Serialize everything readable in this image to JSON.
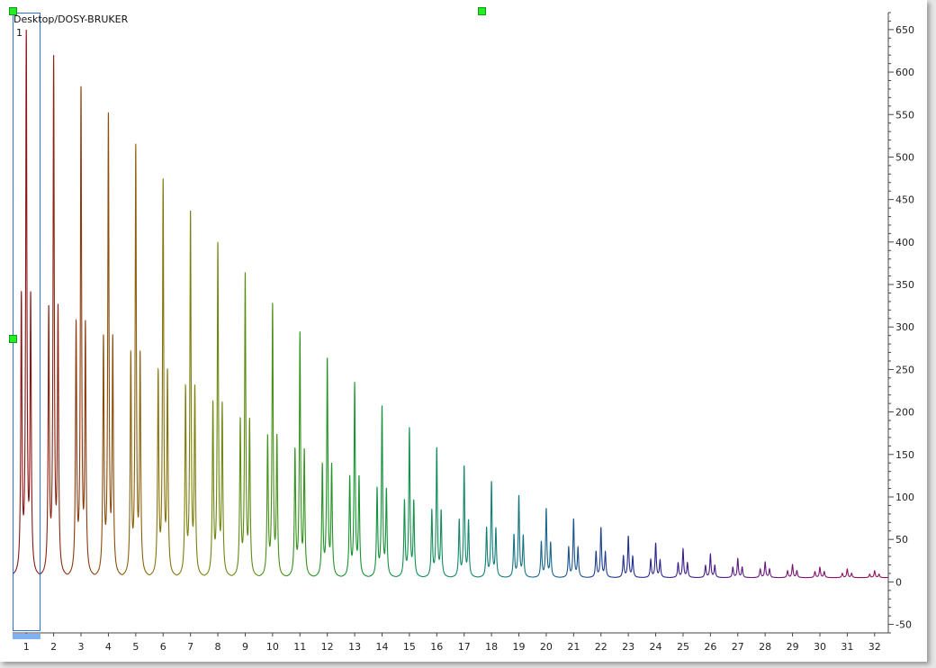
{
  "document": {
    "title": "Desktop/DOSY-BRUKER",
    "trace_index": "1"
  },
  "selection": {
    "trace": 1
  },
  "chart_data": {
    "type": "line",
    "title": "",
    "xlabel": "",
    "ylabel": "",
    "xlim": [
      0.5,
      32.5
    ],
    "ylim": [
      -60,
      670
    ],
    "x_ticks": [
      1,
      2,
      3,
      4,
      5,
      6,
      7,
      8,
      9,
      10,
      11,
      12,
      13,
      14,
      15,
      16,
      17,
      18,
      19,
      20,
      21,
      22,
      23,
      24,
      25,
      26,
      27,
      28,
      29,
      30,
      31,
      32
    ],
    "y_ticks": [
      -50,
      0,
      50,
      100,
      150,
      200,
      250,
      300,
      350,
      400,
      450,
      500,
      550,
      600,
      650
    ],
    "y_axis_side": "right",
    "grid": false,
    "legend": "none",
    "baseline": 5,
    "peak_shape": "lorentzian",
    "peaks_description": "triplet per trace: left, center, right",
    "peak_offsets": [
      -0.18,
      0,
      0.16
    ],
    "traces": [
      {
        "trace": 1,
        "left": 323,
        "center": 630,
        "right": 319,
        "color": "#8b1414"
      },
      {
        "trace": 2,
        "left": 307,
        "center": 601,
        "right": 305,
        "color": "#8a2410"
      },
      {
        "trace": 3,
        "left": 290,
        "center": 565,
        "right": 287,
        "color": "#8a3a0d"
      },
      {
        "trace": 4,
        "left": 274,
        "center": 535,
        "right": 271,
        "color": "#8a4d0b"
      },
      {
        "trace": 5,
        "left": 255,
        "center": 499,
        "right": 253,
        "color": "#8a600a"
      },
      {
        "trace": 6,
        "left": 235,
        "center": 459,
        "right": 233,
        "color": "#86720a"
      },
      {
        "trace": 7,
        "left": 217,
        "center": 422,
        "right": 215,
        "color": "#7e7e0c"
      },
      {
        "trace": 8,
        "left": 199,
        "center": 386,
        "right": 196,
        "color": "#6e870e"
      },
      {
        "trace": 9,
        "left": 180,
        "center": 351,
        "right": 178,
        "color": "#5c8c12"
      },
      {
        "trace": 10,
        "left": 161,
        "center": 316,
        "right": 160,
        "color": "#469016"
      },
      {
        "trace": 11,
        "left": 146,
        "center": 283,
        "right": 144,
        "color": "#31921c"
      },
      {
        "trace": 12,
        "left": 129,
        "center": 253,
        "right": 128,
        "color": "#229424"
      },
      {
        "trace": 13,
        "left": 115,
        "center": 225,
        "right": 114,
        "color": "#18942f"
      },
      {
        "trace": 14,
        "left": 102,
        "center": 198,
        "right": 100,
        "color": "#14923d"
      },
      {
        "trace": 15,
        "left": 88,
        "center": 173,
        "right": 87,
        "color": "#13904c"
      },
      {
        "trace": 16,
        "left": 77,
        "center": 150,
        "right": 76,
        "color": "#128c5b"
      },
      {
        "trace": 17,
        "left": 66,
        "center": 129,
        "right": 65,
        "color": "#12876a"
      },
      {
        "trace": 18,
        "left": 57,
        "center": 111,
        "right": 56,
        "color": "#127f78"
      },
      {
        "trace": 19,
        "left": 49,
        "center": 95,
        "right": 48,
        "color": "#147383"
      },
      {
        "trace": 20,
        "left": 41,
        "center": 80,
        "right": 40,
        "color": "#17648a"
      },
      {
        "trace": 21,
        "left": 35,
        "center": 68,
        "right": 34,
        "color": "#1a528c"
      },
      {
        "trace": 22,
        "left": 30,
        "center": 58,
        "right": 29,
        "color": "#1d3f8c"
      },
      {
        "trace": 23,
        "left": 25,
        "center": 48,
        "right": 24,
        "color": "#212e8a"
      },
      {
        "trace": 24,
        "left": 21,
        "center": 40,
        "right": 20,
        "color": "#2a2388"
      },
      {
        "trace": 25,
        "left": 17,
        "center": 33,
        "right": 17,
        "color": "#3a1e86"
      },
      {
        "trace": 26,
        "left": 14,
        "center": 27,
        "right": 14,
        "color": "#4a1b84"
      },
      {
        "trace": 27,
        "left": 12,
        "center": 22,
        "right": 12,
        "color": "#5a1880"
      },
      {
        "trace": 28,
        "left": 10,
        "center": 18,
        "right": 10,
        "color": "#69167a"
      },
      {
        "trace": 29,
        "left": 8,
        "center": 15,
        "right": 8,
        "color": "#761472"
      },
      {
        "trace": 30,
        "left": 7,
        "center": 12,
        "right": 7,
        "color": "#80126a"
      },
      {
        "trace": 31,
        "left": 5,
        "center": 10,
        "right": 5,
        "color": "#881262"
      },
      {
        "trace": 32,
        "left": 4,
        "center": 8,
        "right": 4,
        "color": "#8e1258"
      }
    ]
  }
}
